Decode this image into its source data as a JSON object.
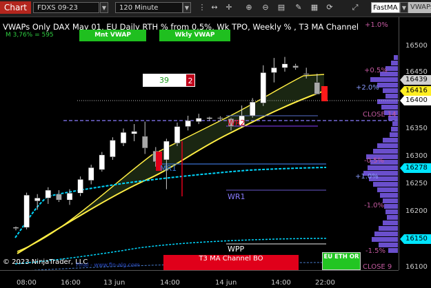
{
  "toolbar": {
    "chart_label": "Chart",
    "instrument": "FDXS 09-23",
    "interval": "120 Minute",
    "indicator_name": "FastMA",
    "indicator2": "VWAPs",
    "icons": [
      "chart-style-icon",
      "bar-spacing-icon",
      "crosshair-icon",
      "zoom-in-icon",
      "zoom-out-icon",
      "properties-icon",
      "drawing-tools-icon",
      "layers-icon",
      "refresh-icon",
      "toolbar-expand-icon"
    ]
  },
  "chart": {
    "title": "VWAPs Only DAX May 01, EU Daily RTH % from 0.5%, Wk TPO, Weekly % , T3 MA Channel",
    "subtitle": "M 3,76% = 595",
    "monthly_vwap_button": "Mnt VWAP",
    "weekly_vwap_button": "Wkly VWAP",
    "counter_left": "39",
    "counter_right": "2",
    "copyright": "© 2023 NinjaTrader, LLC",
    "website": "Final - www.fin-alg.com",
    "bottom_banner": "T3 MA Channel BO",
    "eu_session_button": "EU ETH OR",
    "colors": {
      "bull": "#ffffff",
      "bear": "#a8a8a8",
      "red": "#e0001a",
      "accent_green": "#22c522",
      "profile": "#6a4fcc",
      "vwap": "#00d8ff",
      "ma": "#ffee44"
    }
  },
  "annotations": {
    "mr1": "MR1",
    "wr2": "WR2",
    "wr1": "WR1",
    "wpp": "WPP",
    "pct_pos_1_0": "+1.0%",
    "pct_pos_0_5": "+0.5%",
    "pct_pos_2_0": "+2.0%",
    "close_14": "CLOSE 14",
    "pct_neg_0_5": "-0.5%",
    "pct_pos_1_0b": "+1.0%",
    "pct_neg_1_0": "-1.0%",
    "pct_neg_1_5": "-1.5%",
    "close_9": "CLOSE 9"
  },
  "price_axis": {
    "ticks": [
      "16500",
      "16450",
      "16400",
      "16350",
      "16300",
      "16250",
      "16200",
      "16150",
      "16100"
    ],
    "tags": [
      {
        "name": "price-tag-16439",
        "value": "16439",
        "bg": "#d0d0d0",
        "fg": "#000000"
      },
      {
        "name": "price-tag-16416",
        "value": "16416",
        "bg": "#ffee22",
        "fg": "#000000"
      },
      {
        "name": "price-tag-16400",
        "value": "16400",
        "bg": "#ffffff",
        "fg": "#000000"
      },
      {
        "name": "price-tag-16278",
        "value": "16278",
        "bg": "#00e5ff",
        "fg": "#000000"
      },
      {
        "name": "price-tag-16150",
        "value": "16150",
        "bg": "#00e5ff",
        "fg": "#000000"
      }
    ]
  },
  "time_axis": {
    "ticks": [
      "08:00",
      "16:00",
      "13 jun",
      "14:00",
      "14 jun",
      "14:00",
      "22:00"
    ]
  },
  "chart_data": {
    "type": "candlestick",
    "y_range": [
      16085,
      16545
    ],
    "candles": [
      {
        "o": 16142,
        "h": 16146,
        "l": 16138,
        "c": 16144
      },
      {
        "o": 16144,
        "h": 16215,
        "l": 16140,
        "c": 16210
      },
      {
        "o": 16198,
        "h": 16212,
        "l": 16180,
        "c": 16204
      },
      {
        "o": 16204,
        "h": 16226,
        "l": 16192,
        "c": 16220
      },
      {
        "o": 16212,
        "h": 16220,
        "l": 16196,
        "c": 16200
      },
      {
        "o": 16200,
        "h": 16222,
        "l": 16190,
        "c": 16214
      },
      {
        "o": 16214,
        "h": 16248,
        "l": 16208,
        "c": 16242
      },
      {
        "o": 16240,
        "h": 16272,
        "l": 16232,
        "c": 16266
      },
      {
        "o": 16262,
        "h": 16298,
        "l": 16258,
        "c": 16292
      },
      {
        "o": 16288,
        "h": 16328,
        "l": 16282,
        "c": 16322
      },
      {
        "o": 16316,
        "h": 16346,
        "l": 16310,
        "c": 16338
      },
      {
        "o": 16335,
        "h": 16355,
        "l": 16320,
        "c": 16340
      },
      {
        "o": 16330,
        "h": 16360,
        "l": 16294,
        "c": 16306
      },
      {
        "o": 16300,
        "h": 16308,
        "l": 16268,
        "c": 16278
      },
      {
        "o": 16282,
        "h": 16325,
        "l": 16222,
        "c": 16320
      },
      {
        "o": 16316,
        "h": 16358,
        "l": 16310,
        "c": 16350
      },
      {
        "o": 16350,
        "h": 16372,
        "l": 16342,
        "c": 16362
      },
      {
        "o": 16360,
        "h": 16376,
        "l": 16355,
        "c": 16367
      },
      {
        "o": 16366,
        "h": 16370,
        "l": 16362,
        "c": 16368
      },
      {
        "o": 16368,
        "h": 16371,
        "l": 16363,
        "c": 16366
      },
      {
        "o": 16366,
        "h": 16368,
        "l": 16342,
        "c": 16350
      },
      {
        "o": 16352,
        "h": 16393,
        "l": 16348,
        "c": 16372
      },
      {
        "o": 16372,
        "h": 16408,
        "l": 16368,
        "c": 16400
      },
      {
        "o": 16398,
        "h": 16475,
        "l": 16392,
        "c": 16460
      },
      {
        "o": 16460,
        "h": 16490,
        "l": 16440,
        "c": 16470
      },
      {
        "o": 16470,
        "h": 16492,
        "l": 16462,
        "c": 16478
      },
      {
        "o": 16474,
        "h": 16478,
        "l": 16466,
        "c": 16470
      },
      {
        "o": 16458,
        "h": 16470,
        "l": 16448,
        "c": 16456
      },
      {
        "o": 16440,
        "h": 16458,
        "l": 16420,
        "c": 16416
      }
    ]
  }
}
